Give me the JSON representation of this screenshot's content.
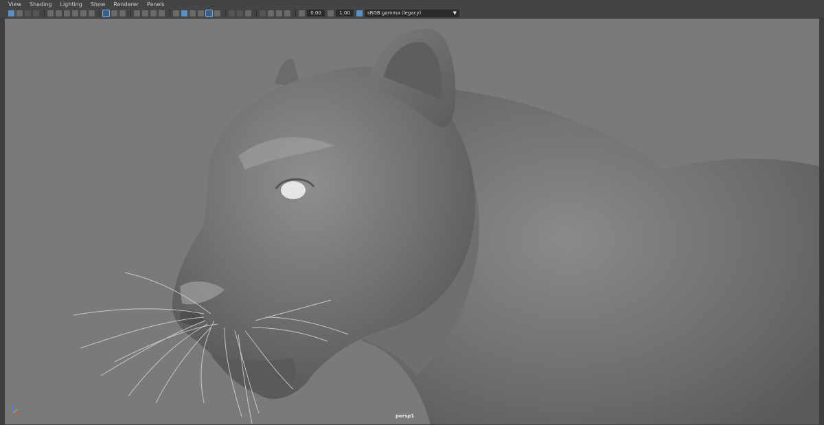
{
  "menu": [
    "View",
    "Shading",
    "Lighting",
    "Show",
    "Renderer",
    "Panels"
  ],
  "toolbar": {
    "exposure": "0.00",
    "gamma": "1.00",
    "color_space": "sRGB gamma (legacy)"
  },
  "viewport": {
    "camera": "persp1"
  },
  "colors": {
    "ui_bg": "#444444",
    "viewport_bg": "#7a7a7a",
    "accent": "#5b8fc6"
  }
}
